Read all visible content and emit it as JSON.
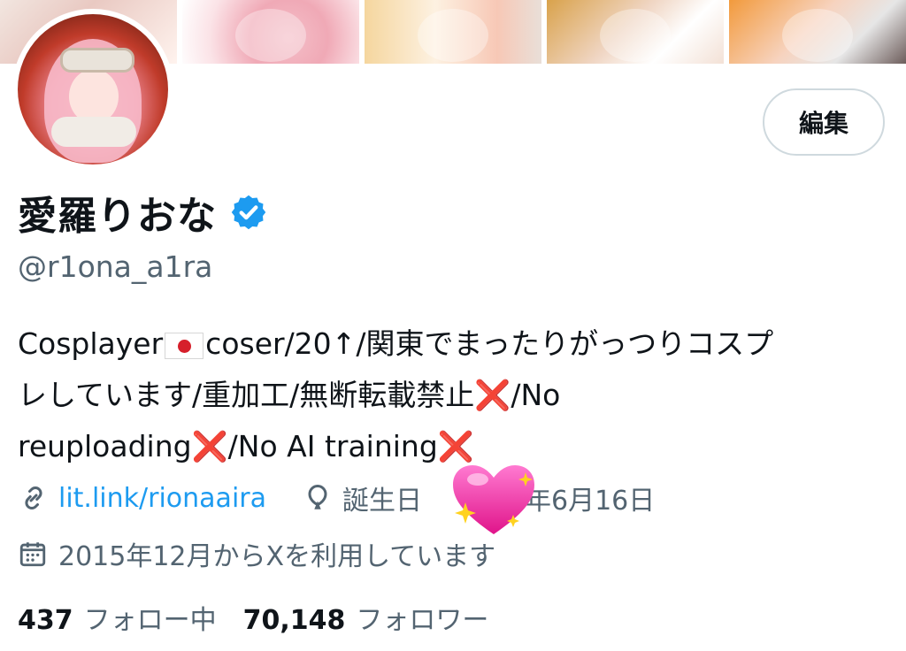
{
  "profile": {
    "display_name": "愛羅りおな",
    "handle": "@r1ona_a1ra",
    "edit_label": "編集",
    "verified_icon": "verified-badge-icon"
  },
  "bio": {
    "line1_a": "Cosplayer",
    "line1_b": "coser/20↑/関東でまったりがっつりコスプ",
    "line2_a": "レしています/重加工/無断転載禁止",
    "line2_b": "/No",
    "line3_a": "reuploading",
    "line3_b": "/No AI training",
    "cross": "❌"
  },
  "meta": {
    "link": "lit.link/rionaaira",
    "birthday_prefix": "誕生日",
    "birthday_suffix": "年6月16日",
    "joined": "2015年12月からXを利用しています"
  },
  "stats": {
    "following_count": "437",
    "following_label": "フォロー中",
    "followers_count": "70,148",
    "followers_label": "フォロワー"
  },
  "colors": {
    "accent": "#1d9bf0",
    "muted": "#536471",
    "text": "#0f1419",
    "cross": "#e0245e"
  }
}
